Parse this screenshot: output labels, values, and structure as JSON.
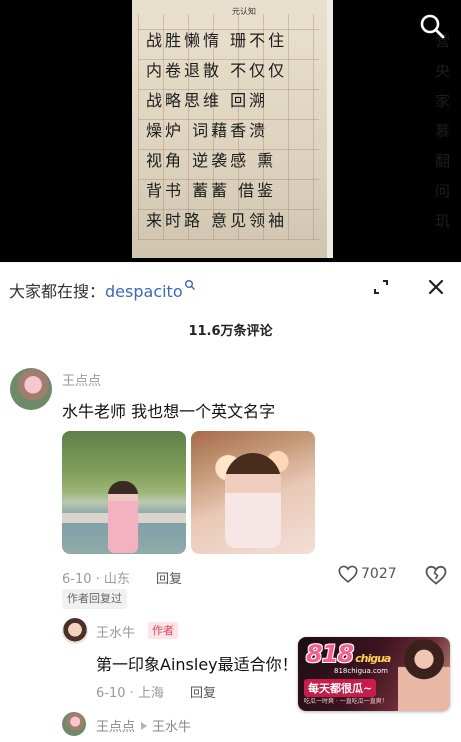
{
  "video": {
    "paper_header": "元认知",
    "paper_lines": [
      "战胜懒惰    珊不住",
      "内卷退散    不仅仅",
      "战略思维    回溯",
      "燥炉    词藉香溃",
      "视角    逆袭感    熏",
      "背书    蓄蓄    借鉴",
      "来时路    意见领袖"
    ],
    "paper_side": [
      "营",
      "央",
      "家",
      "慕",
      "翻",
      "问",
      "玑"
    ]
  },
  "header": {
    "search_prefix": "大家都在搜：",
    "search_keyword": "despacito",
    "comment_count": "11.6万条评论"
  },
  "comment": {
    "username": "王点点",
    "text": "水牛老师 我也想一个英文名字",
    "meta": "6-10 · 山东",
    "reply_label": "回复",
    "likes": "7027",
    "author_replied": "作者回复过"
  },
  "reply": {
    "username": "王水牛",
    "tag": "作者",
    "text": "第一印象Ainsley最适合你！",
    "meta": "6-10 · 上海",
    "reply_label": "回复"
  },
  "thread": {
    "from": "王点点",
    "to": "王水牛"
  },
  "watermark": {
    "logo": "818",
    "logo_sub": "chigua",
    "domain": "818chigua.com",
    "slogan": "每天都很瓜~",
    "small": "吃瓜一时爽 · 一直吃瓜一直爽！"
  },
  "colors": {
    "link_blue": "#3967c8",
    "author_tag_bg": "#fde4e7",
    "author_tag_text": "#e6435b"
  }
}
